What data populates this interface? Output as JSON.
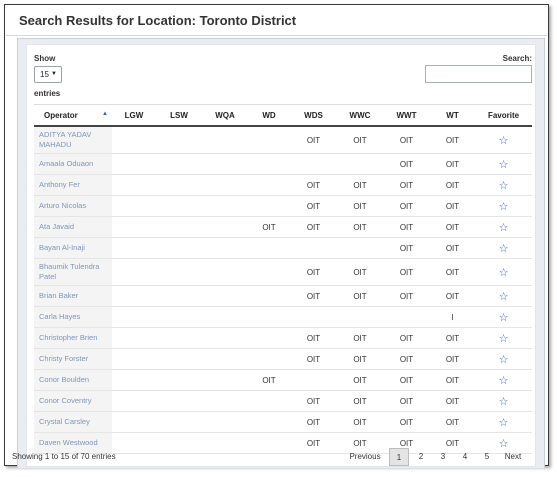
{
  "page": {
    "title": "Search Results for Location: Toronto District"
  },
  "controls": {
    "show_label": "Show",
    "show_value": "15",
    "entries_label": "entries",
    "search_label": "Search:",
    "search_value": ""
  },
  "table": {
    "columns": [
      "Operator",
      "LGW",
      "LSW",
      "WQA",
      "WD",
      "WDS",
      "WWC",
      "WWT",
      "WT",
      "Favorite"
    ],
    "rows": [
      {
        "operator": "ADITYA YADAV MAHADU",
        "LGW": "",
        "LSW": "",
        "WQA": "",
        "WD": "",
        "WDS": "OIT",
        "WWC": "OIT",
        "WWT": "OIT",
        "WT": "OIT",
        "tall": true
      },
      {
        "operator": "Amaala Oduaon",
        "LGW": "",
        "LSW": "",
        "WQA": "",
        "WD": "",
        "WDS": "",
        "WWC": "",
        "WWT": "OIT",
        "WT": "OIT",
        "tall": false
      },
      {
        "operator": "Anthony Fer",
        "LGW": "",
        "LSW": "",
        "WQA": "",
        "WD": "",
        "WDS": "OIT",
        "WWC": "OIT",
        "WWT": "OIT",
        "WT": "OIT",
        "tall": false
      },
      {
        "operator": "Arturo Nicolas",
        "LGW": "",
        "LSW": "",
        "WQA": "",
        "WD": "",
        "WDS": "OIT",
        "WWC": "OIT",
        "WWT": "OIT",
        "WT": "OIT",
        "tall": false
      },
      {
        "operator": "Ata Javaid",
        "LGW": "",
        "LSW": "",
        "WQA": "",
        "WD": "OIT",
        "WDS": "OIT",
        "WWC": "OIT",
        "WWT": "OIT",
        "WT": "OIT",
        "tall": false
      },
      {
        "operator": "Bayan Al-Inaji",
        "LGW": "",
        "LSW": "",
        "WQA": "",
        "WD": "",
        "WDS": "",
        "WWC": "",
        "WWT": "OIT",
        "WT": "OIT",
        "tall": false
      },
      {
        "operator": "Bhaumik Tulendra Patel",
        "LGW": "",
        "LSW": "",
        "WQA": "",
        "WD": "",
        "WDS": "OIT",
        "WWC": "OIT",
        "WWT": "OIT",
        "WT": "OIT",
        "tall": true
      },
      {
        "operator": "Brian Baker",
        "LGW": "",
        "LSW": "",
        "WQA": "",
        "WD": "",
        "WDS": "OIT",
        "WWC": "OIT",
        "WWT": "OIT",
        "WT": "OIT",
        "tall": false
      },
      {
        "operator": "Carla Hayes",
        "LGW": "",
        "LSW": "",
        "WQA": "",
        "WD": "",
        "WDS": "",
        "WWC": "",
        "WWT": "",
        "WT": "I",
        "tall": false
      },
      {
        "operator": "Christopher Brien",
        "LGW": "",
        "LSW": "",
        "WQA": "",
        "WD": "",
        "WDS": "OIT",
        "WWC": "OIT",
        "WWT": "OIT",
        "WT": "OIT",
        "tall": false
      },
      {
        "operator": "Christy Forster",
        "LGW": "",
        "LSW": "",
        "WQA": "",
        "WD": "",
        "WDS": "OIT",
        "WWC": "OIT",
        "WWT": "OIT",
        "WT": "OIT",
        "tall": false
      },
      {
        "operator": "Conor Boulden",
        "LGW": "",
        "LSW": "",
        "WQA": "",
        "WD": "OIT",
        "WDS": "",
        "WWC": "OIT",
        "WWT": "OIT",
        "WT": "OIT",
        "tall": false
      },
      {
        "operator": "Conor Coventry",
        "LGW": "",
        "LSW": "",
        "WQA": "",
        "WD": "",
        "WDS": "OIT",
        "WWC": "OIT",
        "WWT": "OIT",
        "WT": "OIT",
        "tall": false
      },
      {
        "operator": "Crystal Carsley",
        "LGW": "",
        "LSW": "",
        "WQA": "",
        "WD": "",
        "WDS": "OIT",
        "WWC": "OIT",
        "WWT": "OIT",
        "WT": "OIT",
        "tall": false
      },
      {
        "operator": "Daven Westwood",
        "LGW": "",
        "LSW": "",
        "WQA": "",
        "WD": "",
        "WDS": "OIT",
        "WWC": "OIT",
        "WWT": "OIT",
        "WT": "OIT",
        "tall": false
      }
    ]
  },
  "footer": {
    "info": "Showing 1 to 15 of 70 entries",
    "previous": "Previous",
    "pages": [
      "1",
      "2",
      "3",
      "4",
      "5"
    ],
    "current_page": "1",
    "next": "Next"
  },
  "icons": {
    "favorite": "star-outline-icon",
    "sort": "sort-ascending-icon",
    "select": "caret-down-icon"
  },
  "colors": {
    "link": "#7f95b6",
    "star": "#3462b6",
    "header_border": "#444444",
    "panel_bg": "#e9ecf1"
  }
}
